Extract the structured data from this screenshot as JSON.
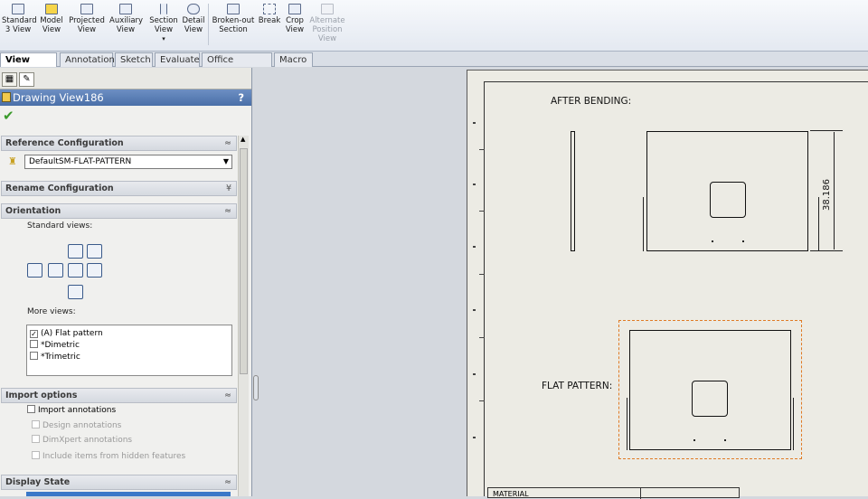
{
  "ribbon": {
    "buttons": [
      {
        "label": "Standard\n3 View",
        "name": "standard-3-view-button",
        "enabled": true
      },
      {
        "label": "Model\nView",
        "name": "model-view-button",
        "enabled": true
      },
      {
        "label": "Projected\nView",
        "name": "projected-view-button",
        "enabled": true
      },
      {
        "label": "Auxiliary\nView",
        "name": "auxiliary-view-button",
        "enabled": true
      },
      {
        "label": "Section\nView",
        "name": "section-view-button",
        "enabled": true
      },
      {
        "label": "Detail\nView",
        "name": "detail-view-button",
        "enabled": true
      },
      {
        "label": "Broken-out\nSection",
        "name": "broken-out-section-button",
        "enabled": true
      },
      {
        "label": "Break",
        "name": "break-button",
        "enabled": true
      },
      {
        "label": "Crop\nView",
        "name": "crop-view-button",
        "enabled": true
      },
      {
        "label": "Alternate\nPosition\nView",
        "name": "alternate-position-view-button",
        "enabled": false
      }
    ]
  },
  "tabs": [
    "View Layout",
    "Annotation",
    "Sketch",
    "Evaluate",
    "Office Products",
    "Macro"
  ],
  "property_manager": {
    "title": "Drawing View186",
    "help": "?",
    "confirm_icon": "checkmark-icon",
    "sections": {
      "reference_configuration": "Reference Configuration",
      "rename_configuration": "Rename Configuration",
      "orientation": "Orientation",
      "import_options": "Import options",
      "display_state": "Display State"
    },
    "configuration_value": "DefaultSM-FLAT-PATTERN",
    "standard_views_label": "Standard views:",
    "more_views_label": "More views:",
    "more_views": [
      {
        "label": "(A) Flat pattern",
        "checked": true
      },
      {
        "label": "*Dimetric",
        "checked": false
      },
      {
        "label": "*Trimetric",
        "checked": false
      }
    ],
    "import_options": [
      {
        "label": "Import annotations",
        "enabled": true
      },
      {
        "label": "Design annotations",
        "enabled": false
      },
      {
        "label": "DimXpert annotations",
        "enabled": false
      },
      {
        "label": "Include items from hidden features",
        "enabled": false
      }
    ]
  },
  "drawing": {
    "after_bending_label": "AFTER BENDING:",
    "flat_pattern_label": "FLAT PATTERN:",
    "dimension": "38.186",
    "title_block_text": "MATERIAL"
  },
  "colors": {
    "selection": "#e07b26",
    "title_bar": "#4a6fa8",
    "sheet": "#ecebe4"
  }
}
